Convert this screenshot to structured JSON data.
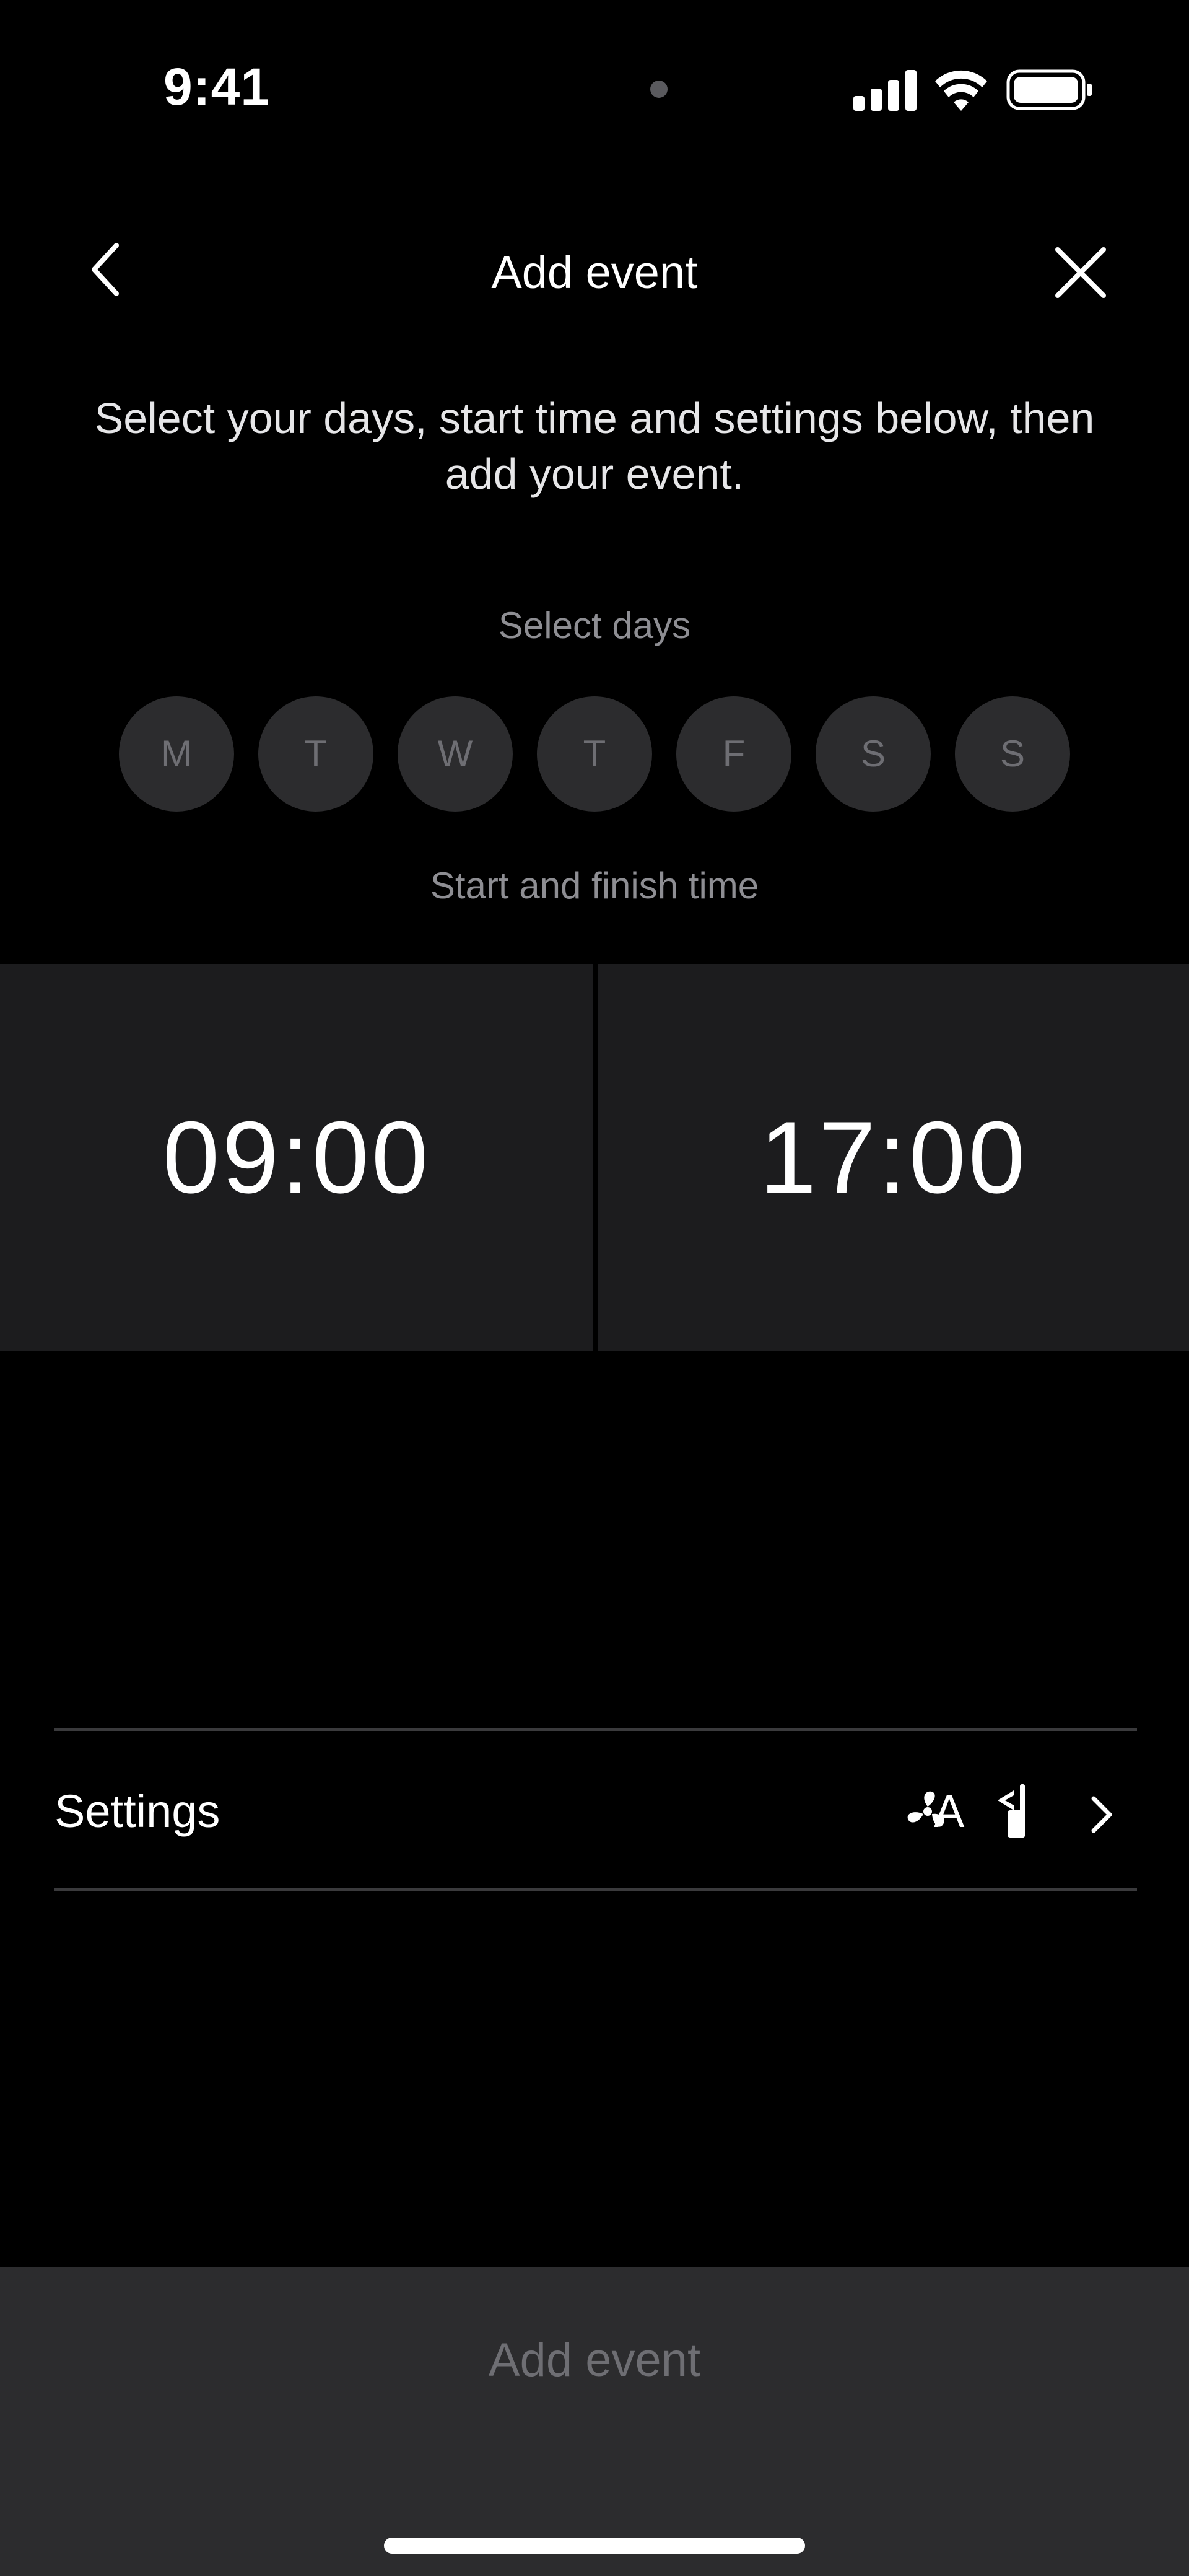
{
  "status_bar": {
    "time": "9:41"
  },
  "nav": {
    "title": "Add event"
  },
  "intro_text": "Select your days, start time and settings below, then add your event.",
  "days": {
    "label": "Select days",
    "items": [
      "M",
      "T",
      "W",
      "T",
      "F",
      "S",
      "S"
    ]
  },
  "time": {
    "label": "Start and finish time",
    "start": "09:00",
    "finish": "17:00"
  },
  "settings": {
    "label": "Settings",
    "mode": "A",
    "icons": [
      "fan-icon",
      "airflow-icon",
      "chevron-right-icon"
    ]
  },
  "footer": {
    "add_label": "Add event"
  },
  "colors": {
    "background": "#000000",
    "panel": "#1c1c1e",
    "day_bg": "#2c2c2e",
    "muted_text": "#8e8e93",
    "disabled_text": "#6e6e73",
    "divider": "#3a3a3c"
  }
}
